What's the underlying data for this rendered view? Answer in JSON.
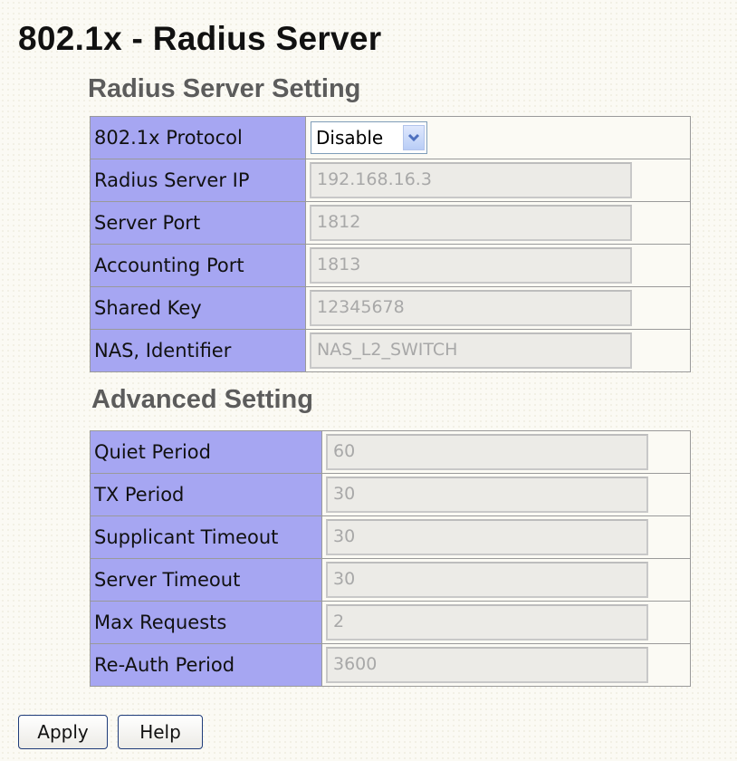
{
  "page": {
    "title": "802.1x - Radius Server"
  },
  "radius_section": {
    "title": "Radius Server Setting",
    "protocol": {
      "label": "802.1x Protocol",
      "value": "Disable"
    },
    "rows": [
      {
        "label": "Radius Server IP",
        "value": "192.168.16.3"
      },
      {
        "label": "Server Port",
        "value": "1812"
      },
      {
        "label": "Accounting Port",
        "value": "1813"
      },
      {
        "label": "Shared Key",
        "value": "12345678"
      },
      {
        "label": "NAS, Identifier",
        "value": "NAS_L2_SWITCH"
      }
    ]
  },
  "advanced_section": {
    "title": "Advanced Setting",
    "rows": [
      {
        "label": "Quiet Period",
        "value": "60"
      },
      {
        "label": "TX Period",
        "value": "30"
      },
      {
        "label": "Supplicant Timeout",
        "value": "30"
      },
      {
        "label": "Server Timeout",
        "value": "30"
      },
      {
        "label": "Max Requests",
        "value": "2"
      },
      {
        "label": "Re-Auth Period",
        "value": "3600"
      }
    ]
  },
  "buttons": {
    "apply": "Apply",
    "help": "Help"
  },
  "icons": {
    "dropdown": "chevron-down-icon"
  },
  "colors": {
    "label_bg": "#a6a6f2",
    "arrow_color": "#4d6fbf"
  }
}
